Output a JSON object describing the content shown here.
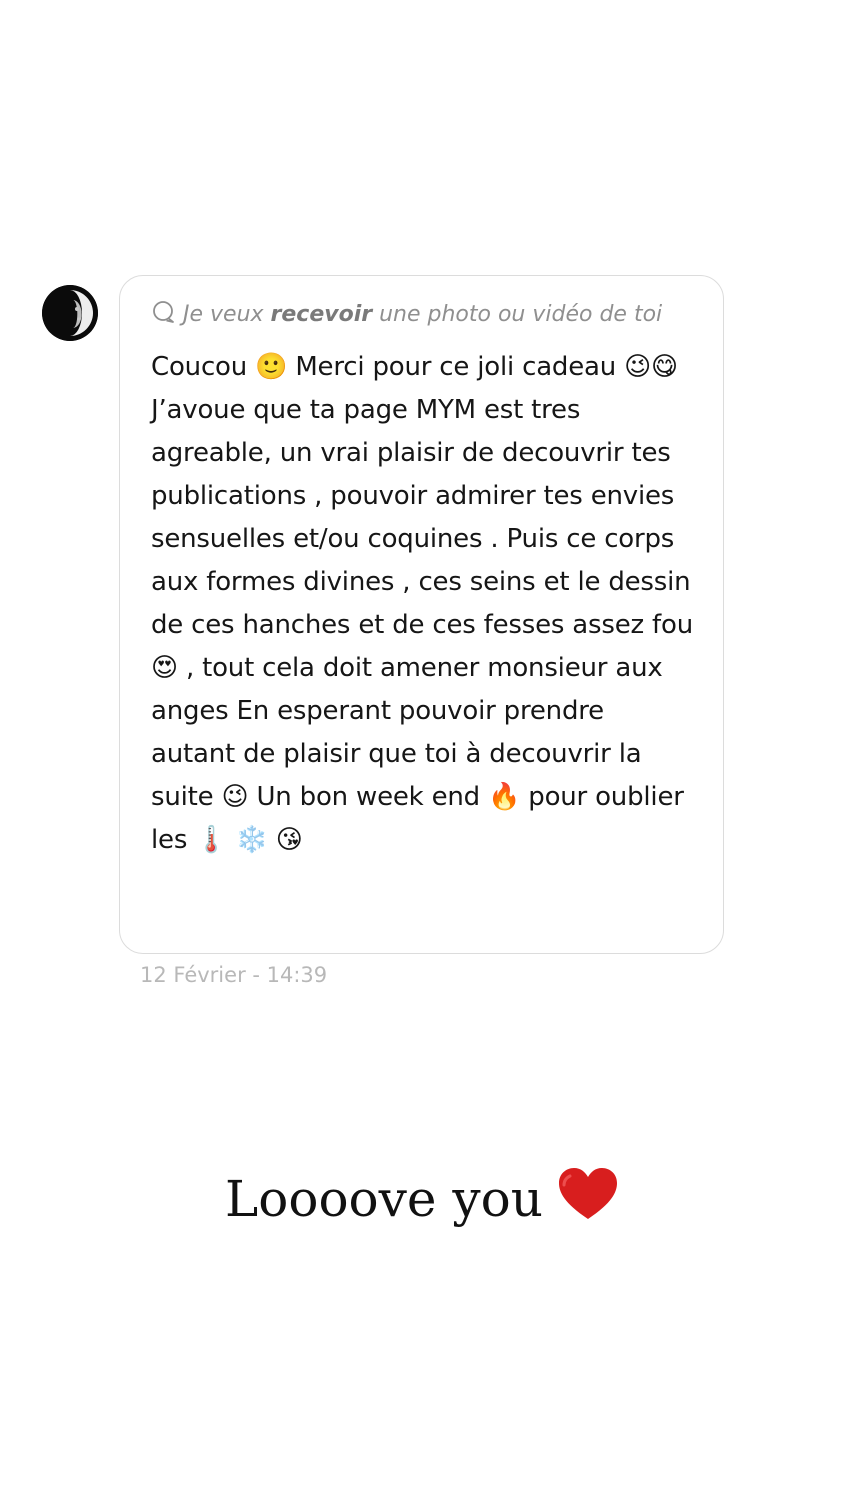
{
  "message": {
    "request": {
      "prefix": "Je veux ",
      "emphasis": "recevoir",
      "suffix": " une photo ou vidéo de toi"
    },
    "body": "Coucou 🙂 Merci pour ce joli cadeau 😉😋 J’avoue que ta page MYM est tres agreable, un vrai plaisir de decouvrir tes publications , pouvoir admirer tes envies sensuelles et/ou coquines . Puis ce corps aux formes divines , ces seins et le dessin de ces hanches et de ces fesses assez fou 😍 , tout cela doit amener monsieur aux anges En esperant pouvoir prendre autant de plaisir que toi à decouvrir la suite 😉 Un bon week end 🔥 pour oublier les 🌡️ ❄️ 😘",
    "timestamp": "12 Février - 14:39"
  },
  "caption": {
    "text": "Loooove you"
  },
  "icons": {
    "avatar": "moon-avatar-icon",
    "request": "speech-bubble-icon",
    "caption": "heart-icon"
  },
  "colors": {
    "heart": "#d81e1e",
    "bubble_border": "#dcdcdc",
    "muted_text": "#8f8f8f",
    "timestamp": "#b8b8b8"
  }
}
